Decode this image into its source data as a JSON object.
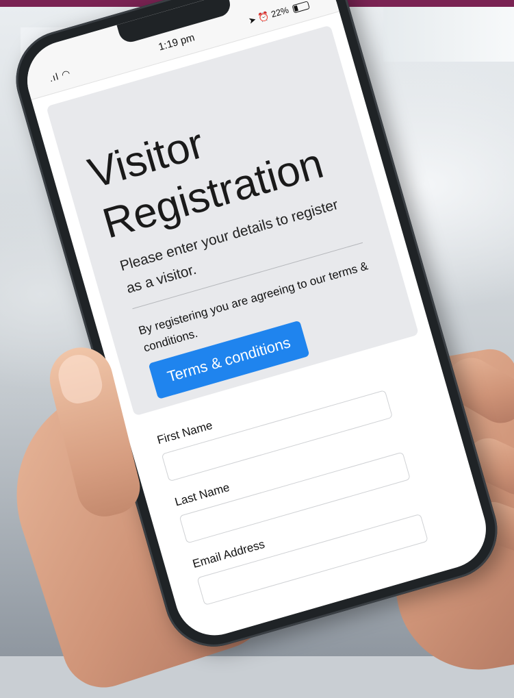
{
  "status_bar": {
    "time": "1:19 pm",
    "battery": "22%"
  },
  "registration": {
    "title_line1": "Visitor",
    "title_line2": "Registration",
    "subtitle": "Please enter your details to register as a visitor.",
    "agreement_text": "By registering you are agreeing to our terms & conditions.",
    "terms_button_label": "Terms & conditions"
  },
  "form": {
    "first_name_label": "First Name",
    "first_name_value": "",
    "last_name_label": "Last Name",
    "last_name_value": "",
    "email_label": "Email Address",
    "email_value": ""
  },
  "colors": {
    "accent_button": "#1f84ee",
    "top_banner": "#7a2353",
    "panel_background": "#e8e9ec"
  },
  "icons": [
    "signal-icon",
    "wifi-icon",
    "location-icon",
    "alarm-icon",
    "battery-icon"
  ]
}
